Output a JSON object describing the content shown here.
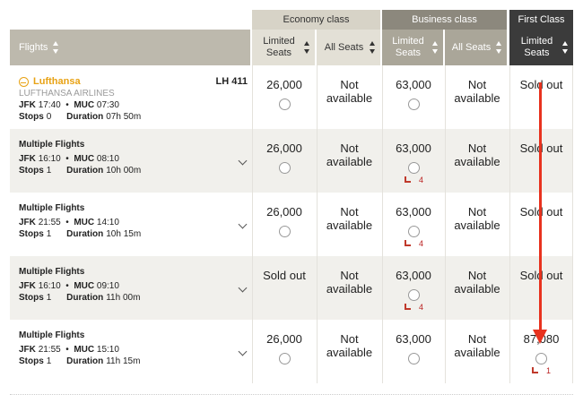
{
  "classes": {
    "economy": "Economy class",
    "business": "Business class",
    "first": "First Class"
  },
  "columns": {
    "flights": "Flights",
    "eco_limited": "Limited Seats",
    "eco_all": "All Seats",
    "bus_limited": "Limited Seats",
    "bus_all": "All Seats",
    "first_limited": "Limited Seats"
  },
  "rows": [
    {
      "logo": "Lufthansa",
      "airline": "LUFTHANSA AIRLINES",
      "flight_no": "LH 411",
      "dep_code": "JFK",
      "dep_time": "17:40",
      "arr_code": "MUC",
      "arr_time": "07:30",
      "stops_label": "Stops",
      "stops": "0",
      "duration_label": "Duration",
      "duration": "07h 50m",
      "eco_limited": "26,000",
      "eco_all": "Not available",
      "bus_limited": "63,000",
      "bus_all": "Not available",
      "first_limited": "Sold out"
    },
    {
      "title": "Multiple Flights",
      "dep_code": "JFK",
      "dep_time": "16:10",
      "arr_code": "MUC",
      "arr_time": "08:10",
      "stops_label": "Stops",
      "stops": "1",
      "duration_label": "Duration",
      "duration": "10h 00m",
      "eco_limited": "26,000",
      "eco_all": "Not available",
      "bus_limited": "63,000",
      "bus_seats_left": "4",
      "bus_all": "Not available",
      "first_limited": "Sold out"
    },
    {
      "title": "Multiple Flights",
      "dep_code": "JFK",
      "dep_time": "21:55",
      "arr_code": "MUC",
      "arr_time": "14:10",
      "stops_label": "Stops",
      "stops": "1",
      "duration_label": "Duration",
      "duration": "10h 15m",
      "eco_limited": "26,000",
      "eco_all": "Not available",
      "bus_limited": "63,000",
      "bus_seats_left": "4",
      "bus_all": "Not available",
      "first_limited": "Sold out"
    },
    {
      "title": "Multiple Flights",
      "dep_code": "JFK",
      "dep_time": "16:10",
      "arr_code": "MUC",
      "arr_time": "09:10",
      "stops_label": "Stops",
      "stops": "1",
      "duration_label": "Duration",
      "duration": "11h 00m",
      "eco_limited": "Sold out",
      "eco_all": "Not available",
      "bus_limited": "63,000",
      "bus_seats_left": "4",
      "bus_all": "Not available",
      "first_limited": "Sold out"
    },
    {
      "title": "Multiple Flights",
      "dep_code": "JFK",
      "dep_time": "21:55",
      "arr_code": "MUC",
      "arr_time": "15:10",
      "stops_label": "Stops",
      "stops": "1",
      "duration_label": "Duration",
      "duration": "11h 15m",
      "eco_limited": "26,000",
      "eco_all": "Not available",
      "bus_limited": "63,000",
      "bus_all": "Not available",
      "first_limited": "87,080",
      "first_seats_left": "1"
    }
  ],
  "colors": {
    "annotation_arrow": "#e8321e",
    "seat_icon": "#c0392b",
    "lufthansa": "#e8a214"
  }
}
